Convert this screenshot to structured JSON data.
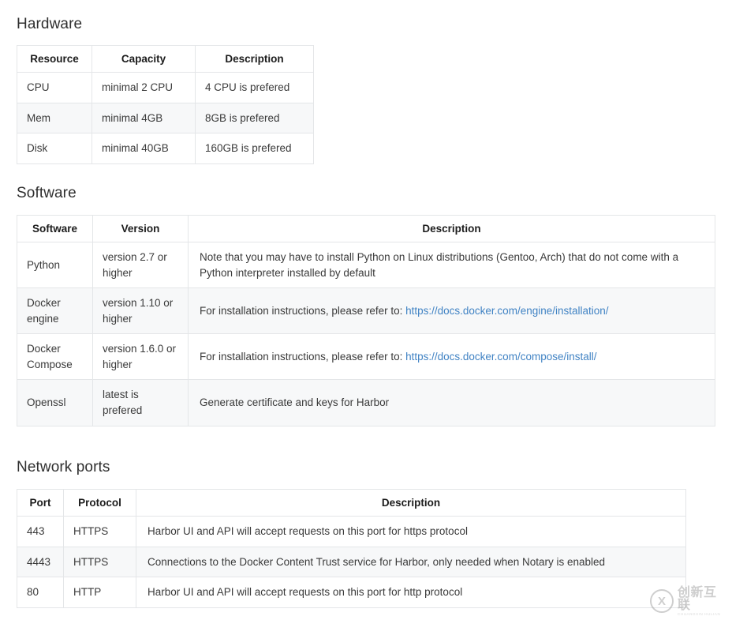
{
  "sections": [
    {
      "id": "hardware",
      "heading": "Hardware",
      "columns": [
        "Resource",
        "Capacity",
        "Description"
      ],
      "rows": [
        [
          "CPU",
          "minimal 2 CPU",
          "4 CPU is prefered"
        ],
        [
          "Mem",
          "minimal 4GB",
          "8GB is prefered"
        ],
        [
          "Disk",
          "minimal 40GB",
          "160GB is prefered"
        ]
      ]
    },
    {
      "id": "software",
      "heading": "Software",
      "columns": [
        "Software",
        "Version",
        "Description"
      ],
      "rows": [
        {
          "name": "Python",
          "version": "version 2.7 or higher",
          "description": "Note that you may have to install Python on Linux distributions (Gentoo, Arch) that do not come with a Python interpreter installed by default",
          "link_prefix": "",
          "link": ""
        },
        {
          "name": "Docker engine",
          "version": "version 1.10 or higher",
          "description": "",
          "link_prefix": "For installation instructions, please refer to: ",
          "link": "https://docs.docker.com/engine/installation/"
        },
        {
          "name": "Docker Compose",
          "version": "version 1.6.0 or higher",
          "description": "",
          "link_prefix": "For installation instructions, please refer to: ",
          "link": "https://docs.docker.com/compose/install/"
        },
        {
          "name": "Openssl",
          "version": "latest is prefered",
          "description": "Generate certificate and keys for Harbor",
          "link_prefix": "",
          "link": ""
        }
      ]
    },
    {
      "id": "network",
      "heading": "Network ports",
      "columns": [
        "Port",
        "Protocol",
        "Description"
      ],
      "rows": [
        [
          "443",
          "HTTPS",
          "Harbor UI and API will accept requests on this port for https protocol"
        ],
        [
          "4443",
          "HTTPS",
          "Connections to the Docker Content Trust service for Harbor, only needed when Notary is enabled"
        ],
        [
          "80",
          "HTTP",
          "Harbor UI and API will accept requests on this port for http protocol"
        ]
      ]
    }
  ],
  "watermark": {
    "logo_glyph": "X",
    "text_cn": "创新互联",
    "text_sub": "CHUANGXIN HULIAN"
  },
  "colors": {
    "link": "#4183c4",
    "border": "#e4e6e8",
    "stripe": "#f7f8f9",
    "text": "#3a3a3a",
    "heading": "#2f2f2f"
  }
}
